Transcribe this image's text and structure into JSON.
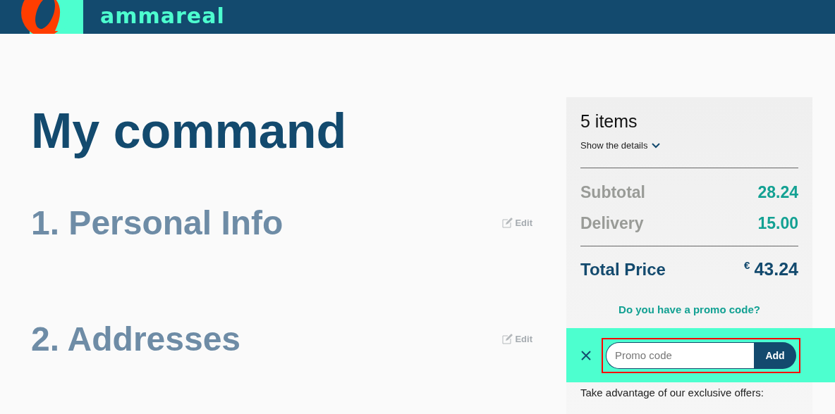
{
  "header": {
    "logo_text": "ammareal"
  },
  "page_title": "My command",
  "sections": [
    {
      "title": "1. Personal Info",
      "action": "Edit"
    },
    {
      "title": "2. Addresses",
      "action": "Edit"
    }
  ],
  "summary": {
    "item_count": "5 items",
    "details_toggle": {
      "label": "Show the details",
      "expanded": false
    },
    "lines": [
      {
        "label": "Subtotal",
        "value": "28.24"
      },
      {
        "label": "Delivery",
        "value": "15.00"
      }
    ],
    "total": {
      "label": "Total Price",
      "currency": "€",
      "value": "43.24"
    },
    "promo_link": "Do you have a promo code?",
    "promo_form": {
      "placeholder": "Promo code",
      "button": "Add",
      "highlighted": true
    },
    "offers_text": "Take advantage of our exclusive offers:"
  }
}
